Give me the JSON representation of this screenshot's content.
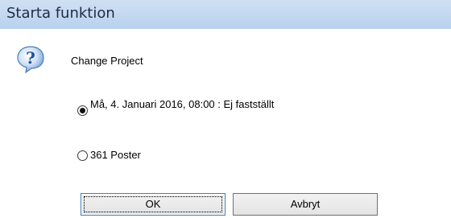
{
  "window": {
    "title": "Starta funktion"
  },
  "dialog": {
    "icon": "question-icon",
    "message": "Change Project",
    "options": [
      {
        "label": "Må, 4. Januari  2016, 08:00 :  Ej fastställt",
        "selected": true
      },
      {
        "label": "361 Poster",
        "selected": false
      }
    ],
    "buttons": {
      "ok_label": "OK",
      "cancel_label": "Avbryt"
    }
  },
  "colors": {
    "titlebar": "#c2d7f0",
    "title_text": "#1f2a44",
    "icon_blue": "#2f6fc0",
    "default_button_border": "#3c7fb1"
  }
}
